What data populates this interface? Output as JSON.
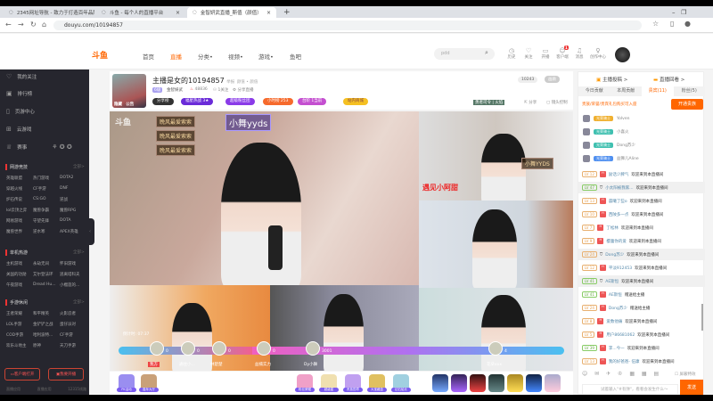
{
  "browser": {
    "tabs": [
      {
        "label": "2345网址导航 - 致力于打造百年品牌"
      },
      {
        "label": "斗鱼 - 每个人的直播平台"
      },
      {
        "label": "金智妍武直播_斯值（颜值）"
      }
    ],
    "url": "douyu.com/10194857"
  },
  "header": {
    "logo": "斗鱼",
    "nav": [
      "首页",
      "直播",
      "分类•",
      "视频•",
      "游戏•",
      "鱼吧"
    ],
    "search_placeholder": "pdd",
    "icons": [
      {
        "label": "历史",
        "icon": "clock-icon"
      },
      {
        "label": "关注",
        "icon": "heart-icon"
      },
      {
        "label": "开播",
        "icon": "camera-icon"
      },
      {
        "label": "客户端",
        "icon": "download-icon"
      },
      {
        "label": "消息",
        "icon": "bell-icon"
      },
      {
        "label": "创作中心",
        "icon": "bulb-icon"
      }
    ],
    "notification_badge": "1"
  },
  "sidebar": {
    "items": [
      "我的关注",
      "排行榜",
      "页游中心",
      "云游戏",
      "赛事"
    ],
    "sections": [
      {
        "title": "网游竞技",
        "more": "全部>",
        "games": [
          "英雄联盟",
          "热门游戏",
          "DOTA2",
          "穿越火线",
          "CF手游",
          "DNF",
          "炉石传说",
          "CS:GO",
          "逆战",
          "lol云顶之弈",
          "魔兽争霸",
          "魔兽RPG",
          "网易游戏",
          "守望先锋",
          "DOTA",
          "魔兽世界",
          "逆水寒",
          "APEX英雄"
        ]
      },
      {
        "title": "单机热游",
        "more": "全部>",
        "games": [
          "主机游戏",
          "永劫无间",
          "怀旧游戏",
          "关国的功勋",
          "艾尔登法环",
          "逃离塔科夫",
          "午夜游戏",
          "Dread Hu...",
          "小榴莲的..."
        ]
      },
      {
        "title": "手游休闲",
        "more": "全部>",
        "games": [
          "王者荣耀",
          "和平精英",
          "火影忍者",
          "LOL手游",
          "金铲铲之战",
          "蛋仔派对",
          "COD手游",
          "哈利波特...",
          "CF手游",
          "欢乐斗地主",
          "原神",
          "天刀手游"
        ]
      }
    ],
    "buttons": [
      "客户端打开",
      "我要开播"
    ],
    "footer": [
      "直播应用",
      "直播应用",
      "12315线路"
    ]
  },
  "room": {
    "title": "主播是女的10194857",
    "report": "举报",
    "tags": "颜值 • 颜值",
    "badge": "6级",
    "category": "金智妍武",
    "hot": "48836",
    "followers": "1关注",
    "subscribe": "分享直播",
    "thumb_labels": [
      "隐藏",
      "公告"
    ],
    "badges": [
      {
        "label": "分享榜",
        "color": "#333"
      },
      {
        "label": "福星热战 3★",
        "color": "#6a2bd8"
      },
      {
        "label": "超级粉丝团",
        "color": "#8a3be8"
      },
      {
        "label": "小时榜 253",
        "color": "#f66a2c"
      },
      {
        "label": "台阶 1当前",
        "color": "#c44fd0"
      },
      {
        "label": "站内商城",
        "color": "#f5c022"
      }
    ],
    "online": "10243",
    "mode": "画质",
    "share": "分享",
    "feedback": "镜头控制",
    "topbadge": "勇者司令 | 火焰"
  },
  "video": {
    "danmaku": [
      "晚风最爱索索",
      "晚风最爱索索",
      "晚风最爱索索",
      "小舞yyds",
      "小舞YYDS",
      "遇见小阿甜"
    ],
    "timer": "倒计时: 07:37",
    "pk_names": [
      "我方",
      "通往小...",
      "林楚楚",
      "益楠实力",
      "Dy小舞",
      "花朵xxx"
    ],
    "pk_scores": [
      "0",
      "0",
      "0",
      "0",
      "3001",
      "4"
    ]
  },
  "gifts": {
    "left": [
      "PK活动",
      "嘉年大厅"
    ],
    "items": [
      "粉丝荣耀",
      "超级星",
      "贵族勋章",
      "大宝藏盒",
      "钻石船长"
    ]
  },
  "chat": {
    "top_links": [
      "主播投稿 >",
      "直播回看 >"
    ],
    "tabs": [
      "今日贡献",
      "本周贡献",
      "贵宾(11)",
      "粉丝(5)"
    ],
    "vip_line": "贵族/荣誉/贵宾礼包购买可入座",
    "open_button": "开通贵族",
    "vips": [
      {
        "name": "Yolven",
        "badge": "光荣骑士"
      },
      {
        "name": "小喜火",
        "badge": "光荣骑士"
      },
      {
        "name": "Dong苏少",
        "badge": "光荣骑士"
      },
      {
        "name": "益狮儿Aline",
        "badge": "光荣骑士"
      }
    ],
    "messages": [
      {
        "lv": "LV 12",
        "user": "励话少脾气",
        "text": "欢迎来到本直播间",
        "hl": false
      },
      {
        "lv": "LV 47",
        "user": "小太阳被我家...",
        "text": "欢迎来到本直播间",
        "hl": true
      },
      {
        "lv": "LV 13",
        "user": "晨曦了些o",
        "text": "欢迎来到本直播间",
        "hl": false
      },
      {
        "lv": "LV 10",
        "user": "西陂多一点",
        "text": "欢迎来到本直播间",
        "hl": false
      },
      {
        "lv": "LV 7",
        "user": "丁松林",
        "text": "欢迎来到本直播间",
        "hl": false
      },
      {
        "lv": "LV 9",
        "user": "樱蕾你的爱",
        "text": "欢迎来到本直播间",
        "hl": false
      },
      {
        "lv": "LV 24",
        "user": "Dong苏少",
        "text": "欢迎来到本直播间",
        "hl": true
      },
      {
        "lv": "LV 12",
        "user": "平淡912453",
        "text": "欢迎来到本直播间",
        "hl": false
      },
      {
        "lv": "LV 41",
        "user": "AE斯恒",
        "text": "欢迎来到本直播间",
        "hl": true
      },
      {
        "lv": "LV 41",
        "user": "AE斯恒",
        "text": "赠送给主播",
        "hl": false
      },
      {
        "lv": "LV 24",
        "user": "Dong苏少",
        "text": "赠送给主播",
        "hl": false
      },
      {
        "lv": "LV 8",
        "user": "爱数他痛",
        "text": "欢迎来到本直播间",
        "hl": false
      },
      {
        "lv": "LV 5",
        "user": "用户86681062",
        "text": "欢迎来到本直播间",
        "hl": false
      },
      {
        "lv": "LV 39",
        "user": "李...今一",
        "text": "欢迎来到本直播间",
        "hl": false
      },
      {
        "lv": "LV 13",
        "user": "我的好爸爸- 伍康",
        "text": "欢迎来到本直播间",
        "hl": false
      }
    ],
    "toolbar": "☺ ✉ ✈ ♔ ▦ ▦ ▤",
    "block_label": "屏蔽特效",
    "input_placeholder": "试着输入\"#有弹\"，看看会发生什么～",
    "send": "发送",
    "send_count": "40"
  }
}
